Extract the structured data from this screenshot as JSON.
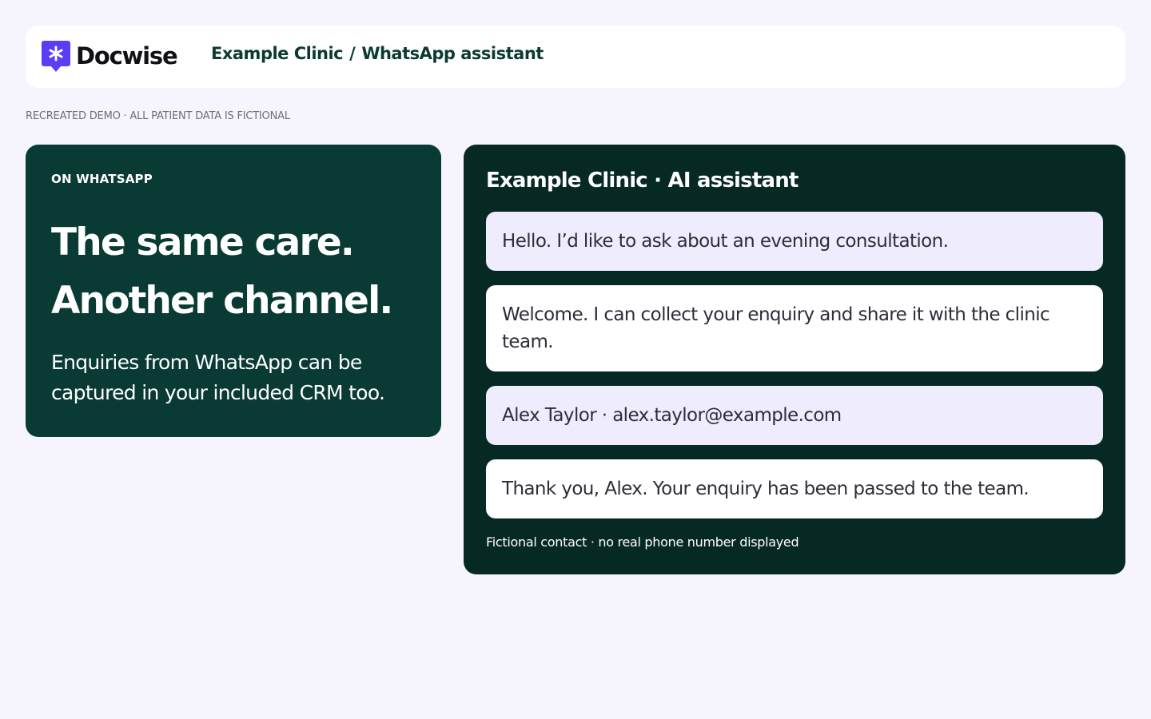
{
  "brand": {
    "name": "Docwise",
    "logo_icon": "asterisk-speech-bubble-icon",
    "logo_color": "#5b3df5"
  },
  "breadcrumb": {
    "clinic": "Example Clinic",
    "separator": "/",
    "page": "WhatsApp assistant"
  },
  "disclaimer": "RECREATED DEMO · ALL PATIENT DATA IS FICTIONAL",
  "promo": {
    "eyebrow": "ON WHATSAPP",
    "headline_line1": "The same care.",
    "headline_line2": "Another channel.",
    "subtext": "Enquiries from WhatsApp can be captured in your included CRM too.",
    "background": "#093a33"
  },
  "chat": {
    "title": "Example Clinic · AI assistant",
    "background": "#062923",
    "messages": [
      {
        "sender": "user",
        "text": "Hello. I’d like to ask about an evening consultation."
      },
      {
        "sender": "assistant",
        "text": "Welcome. I can collect your enquiry and share it with the clinic team."
      },
      {
        "sender": "user",
        "text": "Alex Taylor · alex.taylor@example.com"
      },
      {
        "sender": "assistant",
        "text": "Thank you, Alex. Your enquiry has been passed to the team."
      }
    ],
    "footer": "Fictional contact · no real phone number displayed"
  },
  "colors": {
    "page_background": "#f6f5fd",
    "user_bubble": "#efedfd",
    "assistant_bubble": "#ffffff",
    "breadcrumb_text": "#0b3a33"
  }
}
